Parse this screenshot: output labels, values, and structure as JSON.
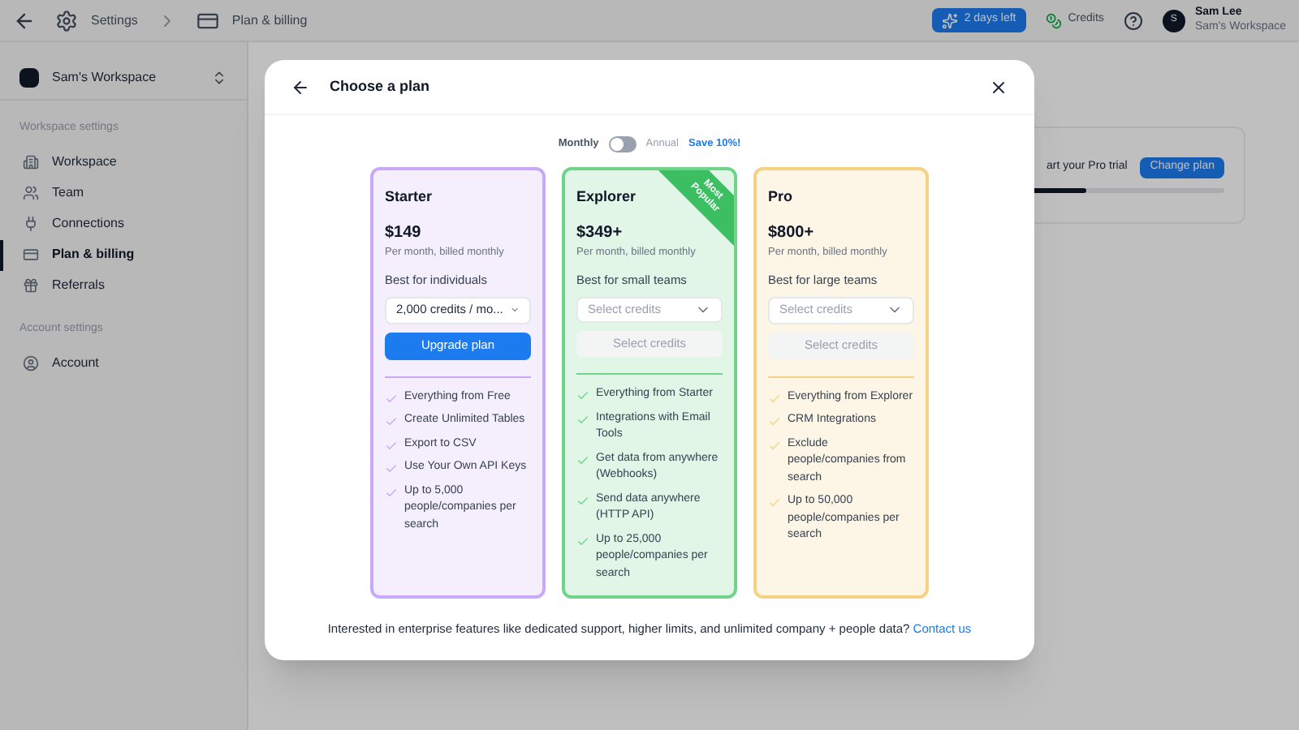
{
  "topbar": {
    "breadcrumb": [
      {
        "label": "Settings"
      },
      {
        "label": "Plan & billing"
      }
    ],
    "trial_button": "2 days left",
    "credits": "Credits",
    "user": {
      "initial": "S",
      "name": "Sam Lee",
      "workspace": "Sam's Workspace"
    }
  },
  "sidebar": {
    "workspace": "Sam's Workspace",
    "sections": [
      {
        "heading": "Workspace settings",
        "items": [
          {
            "label": "Workspace",
            "selected": false
          },
          {
            "label": "Team",
            "selected": false
          },
          {
            "label": "Connections",
            "selected": false
          },
          {
            "label": "Plan & billing",
            "selected": true
          },
          {
            "label": "Referrals",
            "selected": false
          }
        ]
      },
      {
        "heading": "Account settings",
        "items": [
          {
            "label": "Account",
            "selected": false
          }
        ]
      }
    ]
  },
  "background": {
    "trial_text": "art your Pro trial",
    "change_plan": "Change plan",
    "progress": {
      "level": 0.85
    }
  },
  "modal": {
    "title": "Choose a plan",
    "billing": {
      "monthly": "Monthly",
      "annual": "Annual",
      "save": "Save 10%!",
      "on": false
    },
    "plans": [
      {
        "name": "Starter",
        "color": "#c9a8f7",
        "price": "$149",
        "period": "Per month, billed monthly",
        "audience": "Best for individuals",
        "select": {
          "value": "2,000 credits / mo..."
        },
        "button": {
          "label": "Upgrade plan",
          "disabled": false
        },
        "features": [
          "Everything from Free",
          "Create Unlimited Tables",
          "Export to CSV",
          "Use Your Own API Keys",
          "Up to 5,000 people/companies per search"
        ]
      },
      {
        "name": "Explorer",
        "color": "#6fd38a",
        "ribbon": "Most Popular",
        "price": "$349+",
        "period": "Per month, billed monthly",
        "audience": "Best for small teams",
        "select": {
          "placeholder": "Select credits"
        },
        "button": {
          "label": "Select credits",
          "disabled": true
        },
        "features": [
          "Everything from Starter",
          "Integrations with Email Tools",
          "Get data from anywhere (Webhooks)",
          "Send data anywhere (HTTP API)",
          "Up to 25,000 people/companies per search"
        ]
      },
      {
        "name": "Pro",
        "color": "#f4d282",
        "price": "$800+",
        "period": "Per month, billed monthly",
        "audience": "Best for large teams",
        "select": {
          "placeholder": "Select credits"
        },
        "button": {
          "label": "Select credits",
          "disabled": true
        },
        "features": [
          "Everything from Explorer",
          "CRM Integrations",
          "Exclude people/companies from search",
          "Up to 50,000 people/companies per search"
        ]
      }
    ],
    "footer": {
      "text": "Interested in enterprise features like dedicated support, higher limits, and unlimited company + people data?",
      "link": "Contact us"
    }
  }
}
